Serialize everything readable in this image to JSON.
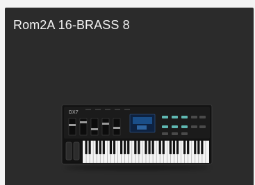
{
  "tile": {
    "title": "Rom2A 16-BRASS 8",
    "image_icon": "synthesizer-keyboard-icon",
    "brand_text": "DX7"
  },
  "colors": {
    "page_background": "#f3f3f3",
    "tile_background": "#2b2b2b",
    "title_text": "#f2f2f2",
    "display_glow": "#1e5a9a",
    "button_teal": "#5fb7b1"
  }
}
